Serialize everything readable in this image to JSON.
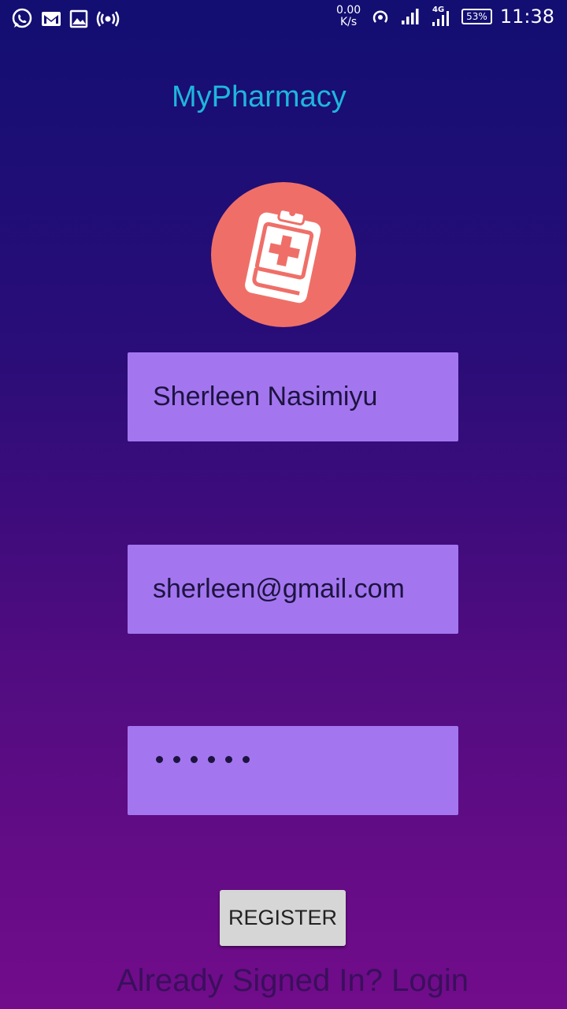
{
  "status_bar": {
    "left_icons": [
      "whatsapp-icon",
      "gmail-icon",
      "image-icon",
      "hotspot-icon"
    ],
    "net_speed_value": "0.00",
    "net_speed_unit": "K/s",
    "network_type": "4G",
    "battery": "53%",
    "time": "11:38"
  },
  "app": {
    "title": "MyPharmacy",
    "logo_icon": "medical-clipboard-icon"
  },
  "form": {
    "name_value": "Sherleen Nasimiyu",
    "email_value": "sherleen@gmail.com",
    "password_mask": "••••••",
    "register_label": "REGISTER",
    "login_link": "Already Signed In? Login"
  },
  "colors": {
    "title": "#1fb6dc",
    "logo_bg": "#ef6f68",
    "field_bg": "#a376ef",
    "gradient_top": "#120e72",
    "gradient_bottom": "#720c8a"
  }
}
